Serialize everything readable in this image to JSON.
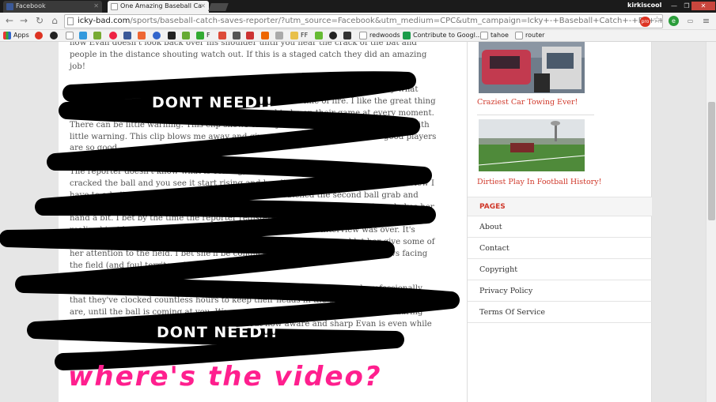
{
  "browser": {
    "tabs": [
      {
        "title": "Facebook",
        "active": false
      },
      {
        "title": "One Amazing Baseball Ca",
        "active": true
      }
    ],
    "profile_name": "kirkiscool",
    "url_domain": "icky-bad.com",
    "url_path": "/sports/baseball-catch-saves-reporter/?utm_source=Facebook&utm_medium=CPC&utm_campaign=Icky+-+Baseball+Catch+-+FB+-+US+-"
  },
  "bookmarks": {
    "apps_label": "Apps",
    "items": [
      "F",
      "FF",
      "redwoods",
      "Contribute to Googl...",
      "tahoe",
      "router"
    ]
  },
  "article": {
    "paragraphs": [
      "how Evan doesn't look back over his shoulder until you hear the crack of the bat and people in the distance shouting watch out. If this is a staged catch they did an amazing job!",
      "Athletes are used to having to react quickly and this video goes to show exactly what kind of difference that can make when someone is in the line of fire. I like the great thing about being a professional athlete is that you need to be on their game at every moment. There can be little warning. This clip shows exactly how quickly things can change with little warning. This clip blows me away and gives you a reminder of why the good players are so good.",
      "The reporter doesn't know what is coming, she is facing away from the field when he cracked the ball and you see it start rising and heading in the direction of the interview I have to admit that my pulse kicked up a bit when I watched the second ball grab and love the way that Evan just throws the ball back towards the mound and then shakes her hand a bit. I bet by the time the reporter registered exactly what had happened and realized just how close she was to being severely injured the interview was over. It's great that he was able to give the interview back to the reporter and let her give some of her attention to the field. I bet she'll be conducting all of her baseball interviews facing the field (and foul territory for that matter).",
      "I think this just shows how these players know what they are doing and professionally that they've clocked countless hours to keep their heads in the game. It's heading guys are, until the ball is coming at you. We see amazing and talented these catches during regular game play but there's something about how aware and sharp Evan is even while doing an interview that reminds you just how good these guys at the office."
    ]
  },
  "sidebar": {
    "posts": [
      {
        "title": "Craziest Car Towing Ever!"
      },
      {
        "title": "Dirtiest Play In Football History!"
      }
    ],
    "pages_title": "PAGES",
    "pages": [
      "About",
      "Contact",
      "Copyright",
      "Privacy Policy",
      "Terms Of Service"
    ]
  },
  "annotations": {
    "note1": "DONT NEED!!",
    "note2": "DONT NEED!!",
    "note3": "where's the video?",
    "scribble_color": "#000000",
    "note_color": "#ff1f8e"
  }
}
